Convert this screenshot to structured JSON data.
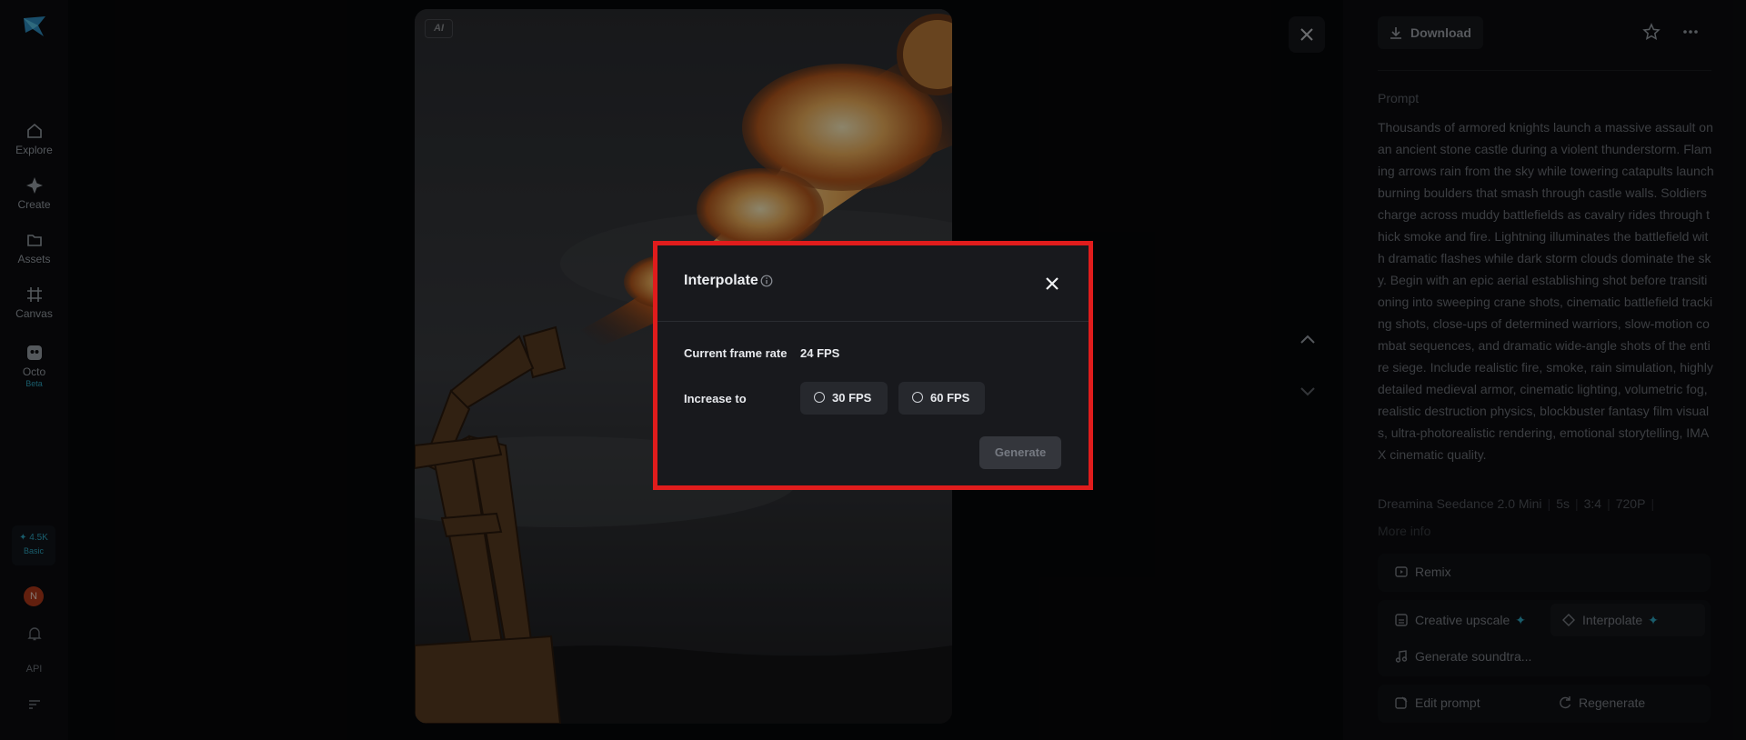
{
  "sidebar": {
    "items": [
      {
        "label": "Explore",
        "icon": "home-icon"
      },
      {
        "label": "Create",
        "icon": "sparkle-icon"
      },
      {
        "label": "Assets",
        "icon": "folder-icon"
      },
      {
        "label": "Canvas",
        "icon": "canvas-icon"
      },
      {
        "label": "Octo",
        "icon": "octo-icon",
        "sub": "Beta"
      }
    ],
    "credits_value": "✦ 4.5K",
    "credits_tier": "Basic",
    "avatar_initial": "N",
    "api_label": "API"
  },
  "viewer": {
    "ai_badge": "AI"
  },
  "panel": {
    "download_label": "Download",
    "prompt_heading": "Prompt",
    "prompt_text": "Thousands of armored knights launch a massive assault on an ancient stone castle during a violent thunderstorm. Flaming arrows rain from the sky while towering catapults launch burning boulders that smash through castle walls. Soldiers charge across muddy battlefields as cavalry rides through thick smoke and fire. Lightning illuminates the battlefield with dramatic flashes while dark storm clouds dominate the sky. Begin with an epic aerial establishing shot before transitioning into sweeping crane shots, cinematic battlefield tracking shots, close-ups of determined warriors, slow-motion combat sequences, and dramatic wide-angle shots of the entire siege. Include realistic fire, smoke, rain simulation, highly detailed medieval armor, cinematic lighting, volumetric fog, realistic destruction physics, blockbuster fantasy film visuals, ultra-photorealistic rendering, emotional storytelling, IMAX cinematic quality.",
    "meta": [
      "Dreamina Seedance 2.0 Mini",
      "5s",
      "3:4",
      "720P"
    ],
    "meta_more": "More info",
    "remix_label": "Remix",
    "tools": {
      "upscale_label": "Creative upscale",
      "interpolate_label": "Interpolate",
      "soundtrack_label": "Generate soundtra..."
    },
    "edit_prompt_label": "Edit prompt",
    "regenerate_label": "Regenerate"
  },
  "modal": {
    "title": "Interpolate",
    "current_label": "Current frame rate",
    "current_value": "24 FPS",
    "increase_label": "Increase to",
    "options": [
      "30 FPS",
      "60 FPS"
    ],
    "selected_option": null,
    "generate_label": "Generate"
  },
  "colors": {
    "accent": "#2ea8c4",
    "highlight_border": "#e01c1c",
    "modal_bg": "#18191d"
  }
}
